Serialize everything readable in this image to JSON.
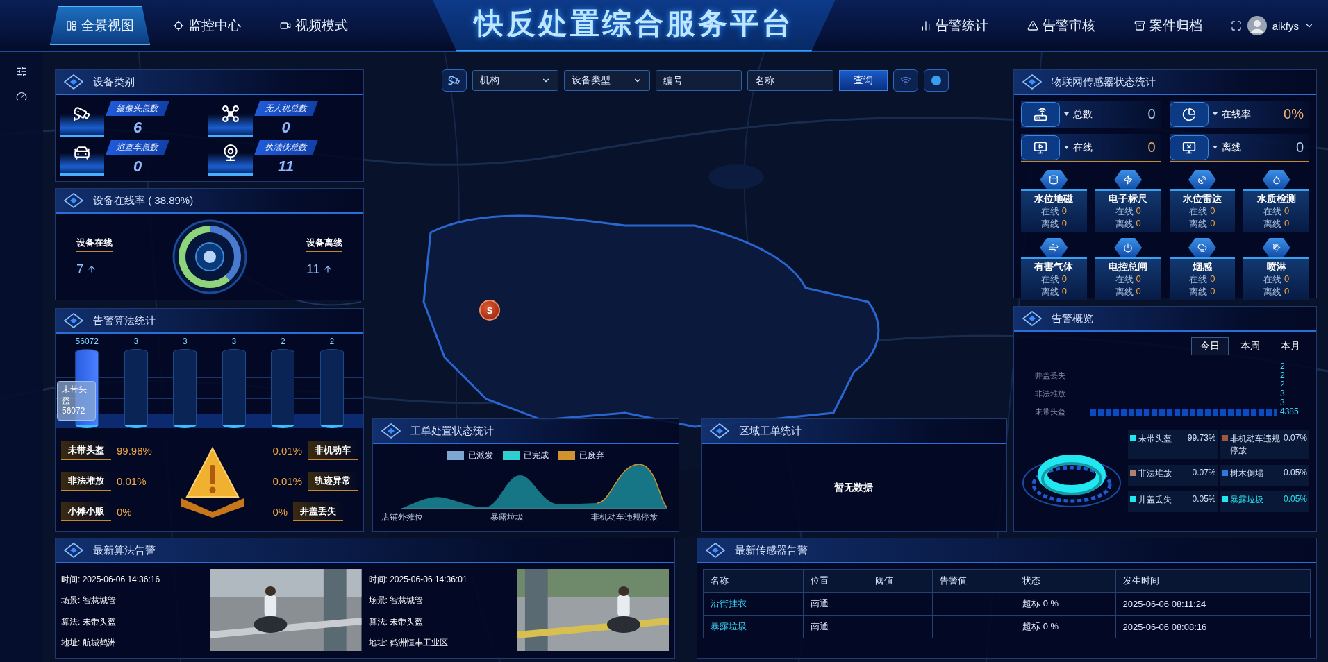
{
  "header": {
    "left_tabs": [
      {
        "label": "全景视图",
        "selected": true
      },
      {
        "label": "监控中心",
        "selected": false
      },
      {
        "label": "视频模式",
        "selected": false
      }
    ],
    "title": "快反处置综合服务平台",
    "right_tabs": [
      {
        "label": "告警统计",
        "selected": false
      },
      {
        "label": "告警审核",
        "selected": false
      },
      {
        "label": "案件归档",
        "selected": false
      }
    ],
    "user": {
      "name": "aikfys"
    }
  },
  "map_marker": {
    "label": "S"
  },
  "toolbar": {
    "selects": [
      {
        "value": "机构"
      },
      {
        "value": "设备类型"
      }
    ],
    "inputs": [
      {
        "placeholder": "编号"
      },
      {
        "placeholder": "名称"
      }
    ],
    "button": "查询"
  },
  "device_category": {
    "title": "设备类别",
    "items": [
      {
        "label": "摄像头总数",
        "value": "6"
      },
      {
        "label": "无人机总数",
        "value": "0"
      },
      {
        "label": "巡查车总数",
        "value": "0"
      },
      {
        "label": "执法仪总数",
        "value": "11"
      }
    ]
  },
  "online_rate": {
    "title": "设备在线率 ( 38.89%)",
    "online": {
      "label": "设备在线",
      "value": "7"
    },
    "offline": {
      "label": "设备离线",
      "value": "11"
    }
  },
  "alarm_algorithms": {
    "title": "告警算法统计",
    "bars": [
      {
        "value": "56072",
        "level": 1
      },
      {
        "value": "3",
        "level": 0
      },
      {
        "value": "3",
        "level": 0
      },
      {
        "value": "3",
        "level": 0
      },
      {
        "value": "2",
        "level": 0
      },
      {
        "value": "2",
        "level": 0
      }
    ],
    "tooltip": {
      "label": "未带头盔",
      "value": "56072"
    },
    "left": [
      {
        "label": "未带头盔",
        "percent": "99.98%"
      },
      {
        "label": "非法堆放",
        "percent": "0.01%"
      },
      {
        "label": "小摊小贩",
        "percent": "0%"
      }
    ],
    "right": [
      {
        "label": "非机动车",
        "percent": "0.01%"
      },
      {
        "label": "轨迹异常",
        "percent": "0.01%"
      },
      {
        "label": "井盖丢失",
        "percent": "0%"
      }
    ]
  },
  "work_orders": {
    "title": "工单处置状态统计",
    "legend": [
      {
        "label": "已派发",
        "color": "#7ea6d2"
      },
      {
        "label": "已完成",
        "color": "#2fcfcf"
      },
      {
        "label": "已废弃",
        "color": "#d0922f"
      }
    ],
    "categories": [
      "店铺外摊位",
      "暴露垃圾",
      "非机动车违规停放"
    ]
  },
  "region_orders": {
    "title": "区域工单统计",
    "empty_text": "暂无数据"
  },
  "iot_sensors": {
    "title": "物联网传感器状态统计",
    "summary": [
      {
        "label": "总数",
        "value": "0",
        "color": "#b7d3f5"
      },
      {
        "label": "在线率",
        "value": "0%",
        "color": "#f0b070"
      },
      {
        "label": "在线",
        "value": "0",
        "color": "#f0b070"
      },
      {
        "label": "离线",
        "value": "0",
        "color": "#b7d3f5"
      }
    ],
    "sensors": [
      {
        "name": "水位地磁",
        "online_label": "在线",
        "online": "0",
        "offline_label": "离线",
        "offline": "0"
      },
      {
        "name": "电子标尺",
        "online_label": "在线",
        "online": "0",
        "offline_label": "离线",
        "offline": "0"
      },
      {
        "name": "水位雷达",
        "online_label": "在线",
        "online": "0",
        "offline_label": "离线",
        "offline": "0"
      },
      {
        "name": "水质检测",
        "online_label": "在线",
        "online": "0",
        "offline_label": "离线",
        "offline": "0"
      },
      {
        "name": "有害气体",
        "online_label": "在线",
        "online": "0",
        "offline_label": "离线",
        "offline": "0"
      },
      {
        "name": "电控总闸",
        "online_label": "在线",
        "online": "0",
        "offline_label": "离线",
        "offline": "0"
      },
      {
        "name": "烟感",
        "online_label": "在线",
        "online": "0",
        "offline_label": "离线",
        "offline": "0"
      },
      {
        "name": "喷淋",
        "online_label": "在线",
        "online": "0",
        "offline_label": "离线",
        "offline": "0"
      }
    ]
  },
  "alarm_overview": {
    "title": "告警概览",
    "periods": [
      {
        "label": "今日",
        "selected": true
      },
      {
        "label": "本周",
        "selected": false
      },
      {
        "label": "本月",
        "selected": false
      }
    ],
    "ranking": [
      {
        "value": "2"
      },
      {
        "label": "井盖丢失",
        "value": "2"
      },
      {
        "value": "2"
      },
      {
        "label": "非法堆放",
        "value": "3"
      },
      {
        "value": "3"
      },
      {
        "label": "未带头盔",
        "value": "4385",
        "level": 1
      }
    ],
    "legend": [
      {
        "label": "未带头盔",
        "percent": "99.73%",
        "color": "#22e6f0",
        "selected": false
      },
      {
        "label": "非机动车违规停放",
        "percent": "0.07%",
        "color": "#a0583a",
        "selected": false
      },
      {
        "label": "非法堆放",
        "percent": "0.07%",
        "color": "#b08070",
        "selected": false
      },
      {
        "label": "树木倒塌",
        "percent": "0.05%",
        "color": "#2a7ad8",
        "selected": false
      },
      {
        "label": "井盖丢失",
        "percent": "0.05%",
        "color": "#22e6f0",
        "selected": false
      },
      {
        "label": "暴露垃圾",
        "percent": "0.05%",
        "color": "#22e6f0",
        "selected": true
      }
    ]
  },
  "latest_algorithm_alerts": {
    "title": "最新算法告警",
    "alerts": [
      {
        "lines": [
          "时间: 2025-06-06 14:36:16",
          "场景: 智慧城管",
          "算法: 未带头盔",
          "地址: 航城鹤洲"
        ]
      },
      {
        "lines": [
          "时间: 2025-06-06 14:36:01",
          "场景: 智慧城管",
          "算法: 未带头盔",
          "地址: 鹤洲恒丰工业区"
        ]
      }
    ]
  },
  "latest_sensor_alerts": {
    "title": "最新传感器告警",
    "columns": [
      "名称",
      "位置",
      "阈值",
      "告警值",
      "状态",
      "发生时间"
    ],
    "rows": [
      {
        "name": "沿街挂衣",
        "location": "南通",
        "status": "超标 0 %",
        "time": "2025-06-06 08:11:24"
      },
      {
        "name": "暴露垃圾",
        "location": "南通",
        "status": "超标 0 %",
        "time": "2025-06-06 08:08:16"
      }
    ]
  }
}
